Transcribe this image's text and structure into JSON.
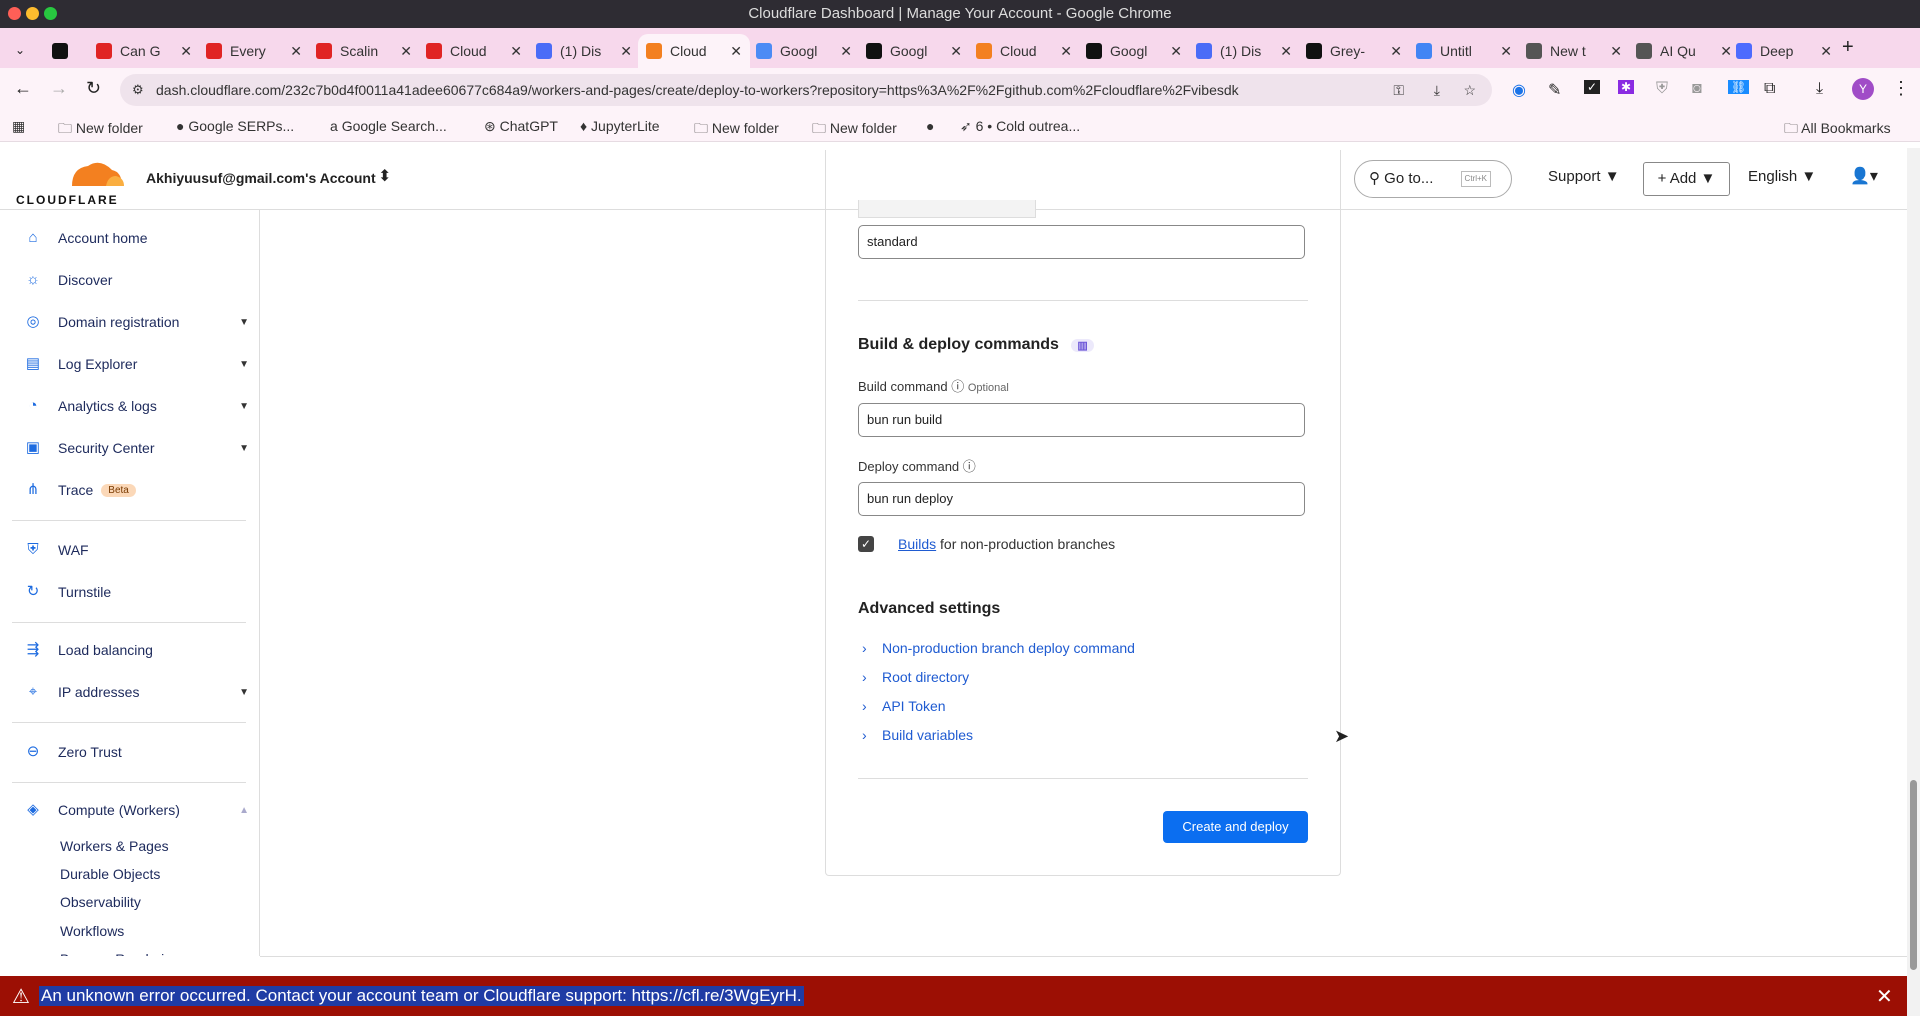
{
  "window": {
    "title": "Cloudflare Dashboard | Manage Your Account - Google Chrome"
  },
  "tabs": [
    {
      "label": "",
      "color": "#111"
    },
    {
      "label": "Can G",
      "color": "#e02424"
    },
    {
      "label": "Every",
      "color": "#e02424"
    },
    {
      "label": "Scalin",
      "color": "#e02424"
    },
    {
      "label": "Cloud",
      "color": "#e02424"
    },
    {
      "label": "(1) Dis",
      "color": "#4a6cf7"
    },
    {
      "label": "Cloud",
      "color": "#f38020",
      "active": true
    },
    {
      "label": "Googl",
      "color": "#4c8bf5"
    },
    {
      "label": "Googl",
      "color": "#111"
    },
    {
      "label": "Cloud",
      "color": "#f38020"
    },
    {
      "label": "Googl",
      "color": "#111"
    },
    {
      "label": "(1) Dis",
      "color": "#4a6cf7"
    },
    {
      "label": "Grey-",
      "color": "#111"
    },
    {
      "label": "Untitl",
      "color": "#4285f4"
    },
    {
      "label": "New t",
      "color": "#555"
    },
    {
      "label": "AI Qu",
      "color": "#555"
    },
    {
      "label": "Deep",
      "color": "#4d6bfe"
    }
  ],
  "address": {
    "url": "dash.cloudflare.com/232c7b0d4f0011a41adee60677c684a9/workers-and-pages/create/deploy-to-workers?repository=https%3A%2F%2Fgithub.com%2Fcloudflare%2Fvibesdk",
    "profile": "Y"
  },
  "bookmarks": [
    "New folder",
    "Google SERPs...",
    "Google Search...",
    "ChatGPT",
    "JupyterLite",
    "New folder",
    "New folder",
    "",
    "6 • Cold outrea..."
  ],
  "all_bookmarks": "All Bookmarks",
  "header": {
    "logo": "CLOUDFLARE",
    "account": "Akhiyuusuf@gmail.com's Account",
    "goto": "Go to...",
    "shortcut": "Ctrl+K",
    "support": "Support",
    "add": "Add",
    "language": "English"
  },
  "sidebar": {
    "items": [
      {
        "label": "Account home",
        "icon": "⌂"
      },
      {
        "label": "Discover",
        "icon": "☼"
      },
      {
        "label": "Domain registration",
        "icon": "◎",
        "caret": true
      },
      {
        "label": "Log Explorer",
        "icon": "▤",
        "caret": true
      },
      {
        "label": "Analytics & logs",
        "icon": "◔",
        "caret": true
      },
      {
        "label": "Security Center",
        "icon": "▣",
        "caret": true
      },
      {
        "label": "Trace",
        "icon": "⋔",
        "badge": "Beta"
      },
      {
        "label": "WAF",
        "icon": "⛨"
      },
      {
        "label": "Turnstile",
        "icon": "↻"
      },
      {
        "label": "Load balancing",
        "icon": "⇶"
      },
      {
        "label": "IP addresses",
        "icon": "⌖",
        "caret": true
      },
      {
        "label": "Zero Trust",
        "icon": "⊖"
      },
      {
        "label": "Compute (Workers)",
        "icon": "◈",
        "expanded": true
      }
    ],
    "subitems": [
      "Workers & Pages",
      "Durable Objects",
      "Observability",
      "Workflows",
      "Browser Rendering"
    ]
  },
  "form": {
    "prev_value": "standard",
    "section_title": "Build & deploy commands",
    "build_label": "Build command",
    "optional": "Optional",
    "build_value": "bun run build",
    "deploy_label": "Deploy command",
    "deploy_value": "bun run deploy",
    "checkbox_link": "Builds",
    "checkbox_text": " for non-production branches",
    "checkbox_checked": true,
    "advanced_title": "Advanced settings",
    "advanced": [
      "Non-production branch deploy command",
      "Root directory",
      "API Token",
      "Build variables"
    ],
    "submit": "Create and deploy"
  },
  "error": {
    "message": "An unknown error occurred. Contact your account team or Cloudflare support: https://cfl.re/3WgEyrH."
  }
}
